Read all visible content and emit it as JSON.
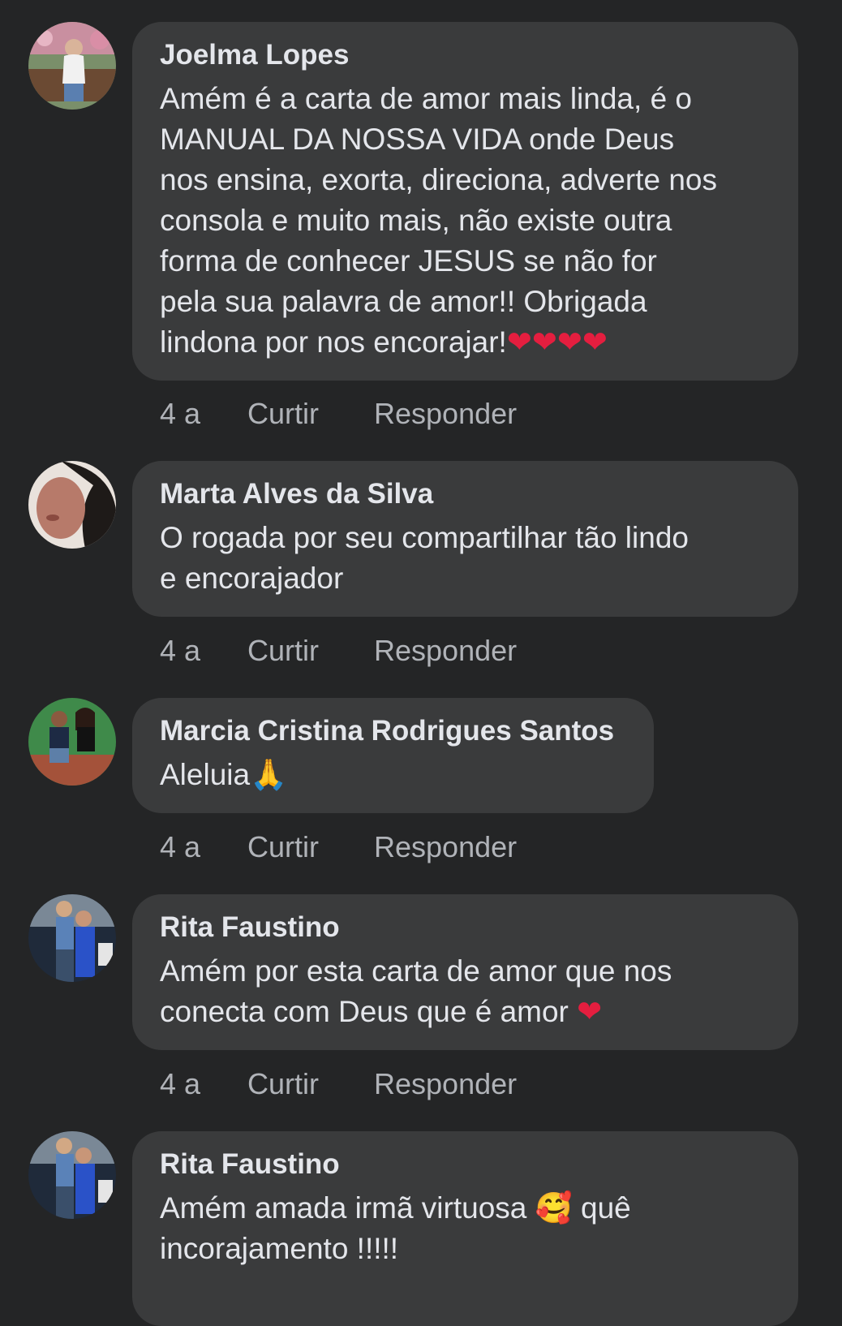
{
  "comments": [
    {
      "author": "Joelma Lopes",
      "text": "Amém é a carta de amor mais linda, é o\nMANUAL DA NOSSA VIDA onde Deus\nnos ensina, exorta, direciona, adverte nos\nconsola e muito mais, não existe outra\nforma de conhecer JESUS se não for\npela sua palavra de amor!! Obrigada\nlindona por nos encorajar!",
      "emoji": "❤❤❤❤",
      "time": "4 a",
      "like": "Curtir",
      "reply": "Responder"
    },
    {
      "author": "Marta Alves da Silva",
      "text": "O rogada por seu compartilhar tão lindo\ne encorajador",
      "emoji": "",
      "time": "4 a",
      "like": "Curtir",
      "reply": "Responder"
    },
    {
      "author": "Marcia Cristina Rodrigues Santos",
      "text": "Aleluia",
      "emoji": "🙏",
      "time": "4 a",
      "like": "Curtir",
      "reply": "Responder"
    },
    {
      "author": "Rita Faustino",
      "text": "Amém por esta carta de amor que nos\nconecta com Deus que é amor ",
      "emoji": "❤",
      "time": "4 a",
      "like": "Curtir",
      "reply": "Responder"
    },
    {
      "author": "Rita Faustino",
      "text_before": "Amém amada irmã virtuosa ",
      "emoji": "🥰",
      "text_after": " quê\nincorajamento !!!!!",
      "time": "",
      "like": "",
      "reply": ""
    }
  ],
  "colors": {
    "background": "#242526",
    "bubble": "#3a3b3c",
    "text": "#e4e6eb",
    "secondary": "#b0b3b8",
    "heart": "#e41e3f"
  }
}
